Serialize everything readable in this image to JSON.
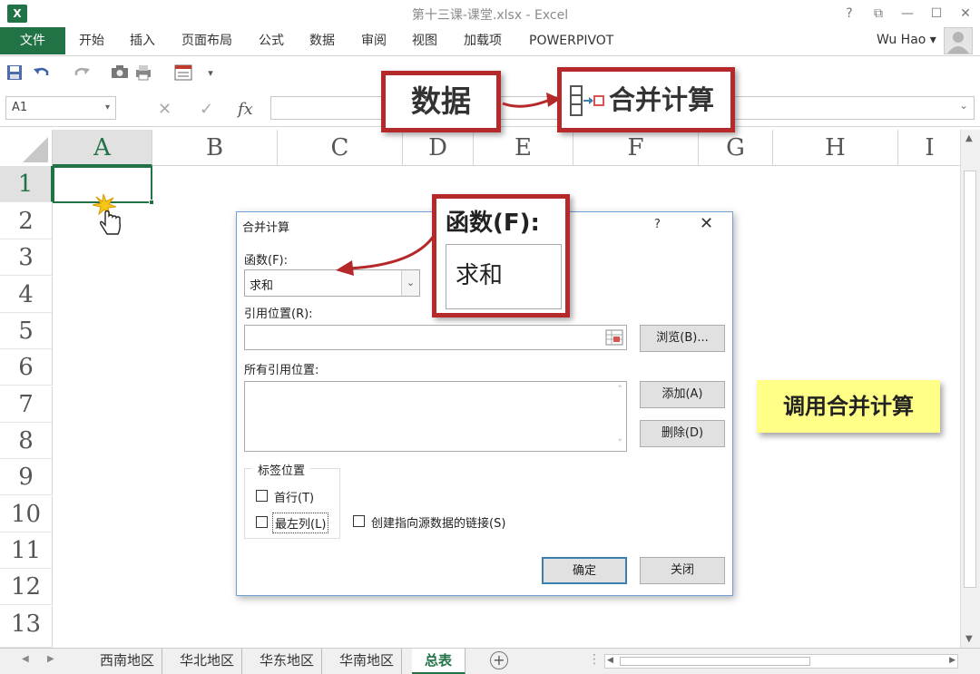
{
  "window": {
    "title": "第十三课-课堂.xlsx - Excel",
    "app_icon": "X",
    "controls": {
      "help": "?",
      "restore_ribbon": "⧉",
      "minimize": "—",
      "maximize": "☐",
      "close": "✕"
    }
  },
  "ribbon": {
    "file_tab": "文件",
    "tabs": [
      "开始",
      "插入",
      "页面布局",
      "公式",
      "数据",
      "审阅",
      "视图",
      "加载项",
      "POWERPIVOT"
    ],
    "user_name": "Wu Hao ▾"
  },
  "formula_bar": {
    "name_box_value": "A1",
    "cancel": "✕",
    "enter": "✓",
    "fx": "fx"
  },
  "columns": [
    "A",
    "B",
    "C",
    "D",
    "E",
    "F",
    "G",
    "H",
    "I"
  ],
  "rows": [
    "1",
    "2",
    "3",
    "4",
    "5",
    "6",
    "7",
    "8",
    "9",
    "10",
    "11",
    "12",
    "13"
  ],
  "selected_cell": "A1",
  "sheet_tabs": {
    "sheets": [
      "西南地区",
      "华北地区",
      "华东地区",
      "华南地区",
      "总表"
    ],
    "active": "总表",
    "add_sheet": "+"
  },
  "annotations": {
    "data_label": "数据",
    "merge_label": "合并计算",
    "func_label": "函数(F):",
    "func_value": "求和",
    "callout": "调用合并计算"
  },
  "dialog": {
    "title": "合并计算",
    "help": "?",
    "close": "✕",
    "function_label": "函数(F):",
    "function_value": "求和",
    "reference_label": "引用位置(R):",
    "reference_value": "",
    "browse_button": "浏览(B)...",
    "all_references_label": "所有引用位置:",
    "add_button": "添加(A)",
    "delete_button": "删除(D)",
    "label_group_title": "标签位置",
    "top_row": "首行(T)",
    "left_column": "最左列(L)",
    "create_links": "创建指向源数据的链接(S)",
    "ok_button": "确定",
    "close_button": "关闭"
  },
  "colors": {
    "excel_green": "#217346",
    "annotation_red": "#b5292b",
    "callout_yellow": "#ffff88"
  }
}
